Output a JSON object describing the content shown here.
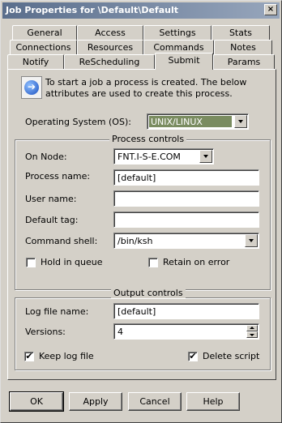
{
  "window": {
    "title": "Job Properties for \\Default\\Default",
    "close_glyph": "×"
  },
  "tabs": {
    "row1": [
      "General",
      "Access",
      "Settings",
      "Stats"
    ],
    "row2": [
      "Connections",
      "Resources",
      "Commands",
      "Notes"
    ],
    "row3": [
      "Notify",
      "ReScheduling",
      "Submit",
      "Params"
    ],
    "active": "Submit"
  },
  "info": {
    "icon": "info-arrow-icon",
    "glyph": "➔",
    "text": "To start a job a process is created.  The below attributes are used to create this process."
  },
  "os": {
    "label": "Operating System (OS):",
    "value": "UNIX/LINUX"
  },
  "process_controls": {
    "title": "Process controls",
    "on_node_label": "On Node:",
    "on_node_value": "FNT.I-S-E.COM",
    "process_name_label": "Process name:",
    "process_name_value": "[default]",
    "user_name_label": "User name:",
    "user_name_value": "",
    "default_tag_label": "Default tag:",
    "default_tag_value": "",
    "command_shell_label": "Command shell:",
    "command_shell_value": "/bin/ksh",
    "hold_in_queue_label": "Hold in queue",
    "hold_in_queue_checked": false,
    "retain_on_error_label": "Retain on error",
    "retain_on_error_checked": false
  },
  "output_controls": {
    "title": "Output controls",
    "log_file_label": "Log file name:",
    "log_file_value": "[default]",
    "versions_label": "Versions:",
    "versions_value": "4",
    "keep_log_label": "Keep log file",
    "keep_log_checked": true,
    "delete_script_label": "Delete script",
    "delete_script_checked": true,
    "check_glyph": "✔"
  },
  "buttons": {
    "ok": "OK",
    "apply": "Apply",
    "cancel": "Cancel",
    "help": "Help"
  }
}
